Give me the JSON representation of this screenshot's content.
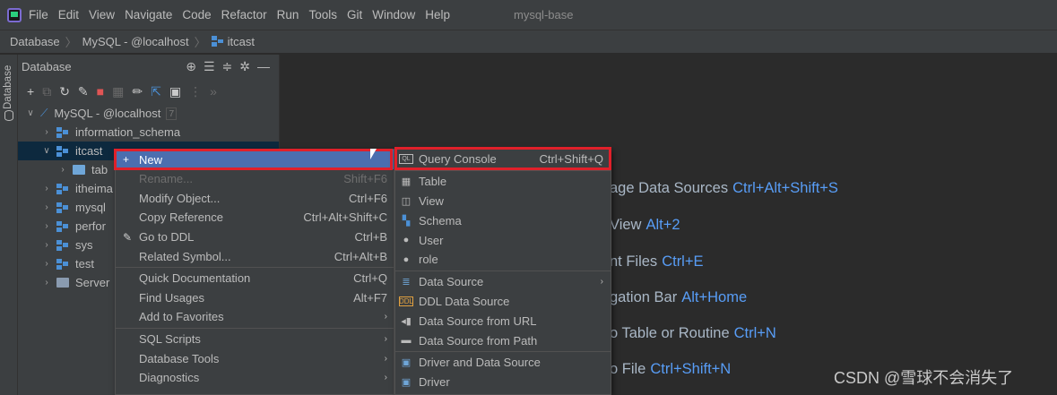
{
  "menubar": {
    "items": [
      "File",
      "Edit",
      "View",
      "Navigate",
      "Code",
      "Refactor",
      "Run",
      "Tools",
      "Git",
      "Window",
      "Help"
    ],
    "project": "mysql-base"
  },
  "breadcrumb": [
    "Database",
    "MySQL - @localhost",
    "itcast"
  ],
  "sidestrip": {
    "label": "Database"
  },
  "panel": {
    "title": "Database",
    "tree": [
      {
        "label": "MySQL - @localhost",
        "count": "7"
      },
      {
        "label": "information_schema"
      },
      {
        "label": "itcast"
      },
      {
        "label": "tab"
      },
      {
        "label": "itheima"
      },
      {
        "label": "mysql"
      },
      {
        "label": "perfor"
      },
      {
        "label": "sys"
      },
      {
        "label": "test"
      },
      {
        "label": "Server"
      }
    ]
  },
  "context_menu": {
    "items": [
      {
        "label": "New",
        "shortcut": ""
      },
      {
        "label": "Rename...",
        "shortcut": "Shift+F6"
      },
      {
        "label": "Modify Object...",
        "shortcut": "Ctrl+F6"
      },
      {
        "label": "Copy Reference",
        "shortcut": "Ctrl+Alt+Shift+C"
      },
      {
        "label": "Go to DDL",
        "shortcut": "Ctrl+B"
      },
      {
        "label": "Related Symbol...",
        "shortcut": "Ctrl+Alt+B"
      },
      {
        "label": "Quick Documentation",
        "shortcut": "Ctrl+Q"
      },
      {
        "label": "Find Usages",
        "shortcut": "Alt+F7"
      },
      {
        "label": "Add to Favorites",
        "shortcut": ""
      },
      {
        "label": "SQL Scripts",
        "shortcut": ""
      },
      {
        "label": "Database Tools",
        "shortcut": ""
      },
      {
        "label": "Diagnostics",
        "shortcut": ""
      }
    ]
  },
  "submenu": {
    "items": [
      {
        "label": "Query Console",
        "shortcut": "Ctrl+Shift+Q"
      },
      {
        "label": "Table",
        "shortcut": ""
      },
      {
        "label": "View",
        "shortcut": ""
      },
      {
        "label": "Schema",
        "shortcut": ""
      },
      {
        "label": "User",
        "shortcut": ""
      },
      {
        "label": "role",
        "shortcut": ""
      },
      {
        "label": "Data Source",
        "shortcut": ""
      },
      {
        "label": "DDL Data Source",
        "shortcut": ""
      },
      {
        "label": "Data Source from URL",
        "shortcut": ""
      },
      {
        "label": "Data Source from Path",
        "shortcut": ""
      },
      {
        "label": "Driver and Data Source",
        "shortcut": ""
      },
      {
        "label": "Driver",
        "shortcut": ""
      }
    ]
  },
  "hints": [
    {
      "text": "age Data Sources",
      "key": "Ctrl+Alt+Shift+S"
    },
    {
      "text": "View",
      "key": "Alt+2"
    },
    {
      "text": "nt Files",
      "key": "Ctrl+E"
    },
    {
      "text": "gation Bar",
      "key": "Alt+Home"
    },
    {
      "text": "o Table or Routine",
      "key": "Ctrl+N"
    },
    {
      "text": "o File",
      "key": "Ctrl+Shift+N"
    }
  ],
  "watermark": "CSDN @雪球不会消失了",
  "colors": {
    "accent": "#4b6eaf",
    "highlight_box": "#e0202a",
    "key_blue": "#589df6"
  }
}
